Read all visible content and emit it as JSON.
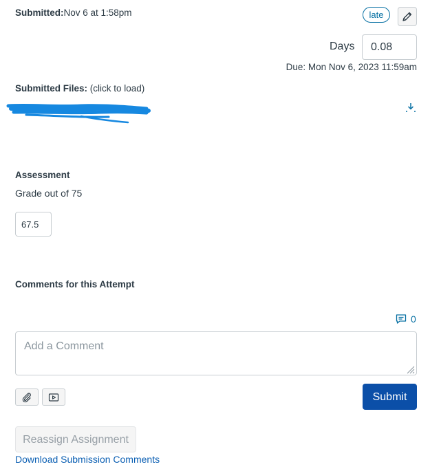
{
  "submission": {
    "submitted_label": "Submitted:",
    "submitted_value": "Nov 6 at 1:58pm",
    "late_badge": "late",
    "days_label": "Days",
    "days_value": "0.08",
    "due": "Due: Mon Nov 6, 2023 11:59am"
  },
  "files": {
    "label": "Submitted Files:",
    "hint": "(click to load)"
  },
  "assessment": {
    "heading": "Assessment",
    "grade_label": "Grade out of 75",
    "grade_value": "67.5"
  },
  "comments": {
    "heading": "Comments for this Attempt",
    "count": "0",
    "placeholder": "Add a Comment",
    "submit_label": "Submit"
  },
  "actions": {
    "reassign_label": "Reassign Assignment",
    "download_comments_label": "Download Submission Comments"
  },
  "icons": {
    "edit": "pencil-icon",
    "download": "download-icon",
    "comment": "comment-icon",
    "attach": "paperclip-icon",
    "media": "media-icon"
  },
  "colors": {
    "accent": "#0770a3",
    "primary_button": "#0b4fa8",
    "text": "#2d3b45",
    "link": "#0b5fb3"
  }
}
